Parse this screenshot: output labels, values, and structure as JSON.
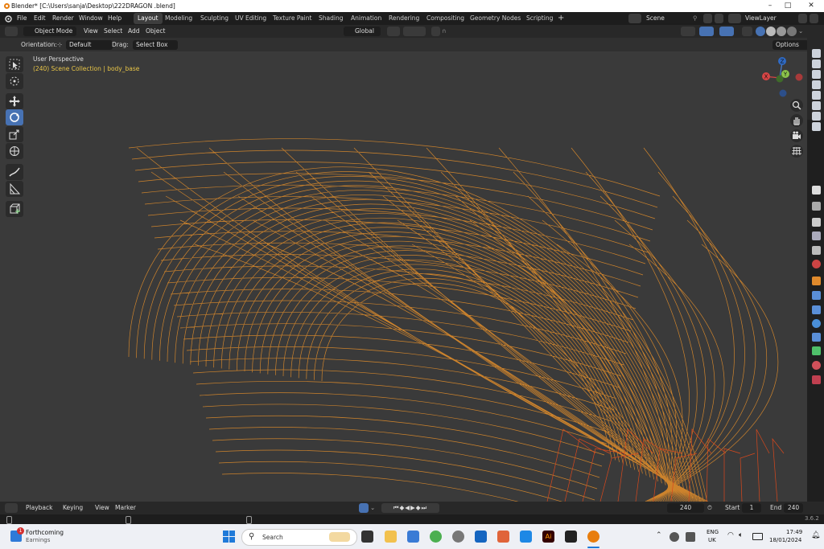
{
  "window": {
    "title": "Blender* [C:\\Users\\sanja\\Desktop\\222DRAGON .blend]",
    "minimize": "–",
    "maximize": "□",
    "close": "✕"
  },
  "menubar": {
    "items": [
      "File",
      "Edit",
      "Render",
      "Window",
      "Help"
    ],
    "workspaces": [
      "Layout",
      "Modeling",
      "Sculpting",
      "UV Editing",
      "Texture Paint",
      "Shading",
      "Animation",
      "Rendering",
      "Compositing",
      "Geometry Nodes",
      "Scripting"
    ],
    "add_tab": "+",
    "scene": "Scene",
    "view_layer": "ViewLayer"
  },
  "viewport_header": {
    "mode": "Object Mode",
    "menus": [
      "View",
      "Select",
      "Add",
      "Object"
    ],
    "transform_orientation": "Global",
    "options": "Options"
  },
  "tool_settings": {
    "orientation_label": "Orientation:",
    "orientation_value": "Default",
    "drag_label": "Drag:",
    "drag_value": "Select Box"
  },
  "viewport": {
    "view_name": "User Perspective",
    "collection_info": "(240) Scene Collection | body_base",
    "wire_color": "#e8902a",
    "gizmo": {
      "x": "X",
      "y": "Y",
      "z": "Z"
    }
  },
  "timeline": {
    "menus": [
      "Playback",
      "Keying",
      "View",
      "Marker"
    ],
    "current_frame": "240",
    "start_label": "Start",
    "start_value": "1",
    "end_label": "End",
    "end_value": "240"
  },
  "statusbar": {
    "version": "3.6.2"
  },
  "taskbar": {
    "news_title": "Forthcoming",
    "news_subtitle": "Earnings",
    "news_badge": "1",
    "search_placeholder": "Search",
    "lang_top": "ENG",
    "lang_bottom": "UK",
    "time": "17:49",
    "date": "18/01/2024"
  }
}
